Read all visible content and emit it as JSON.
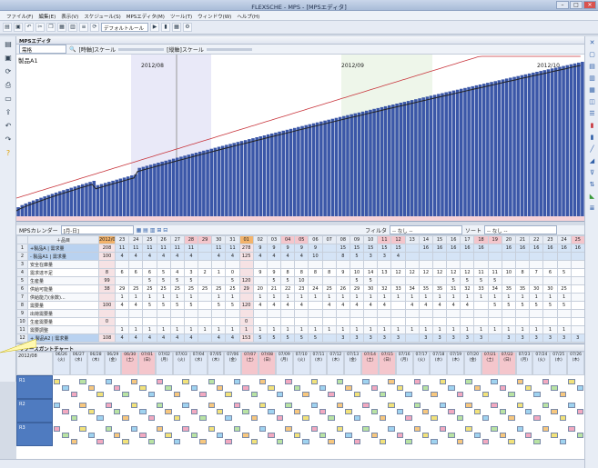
{
  "window": {
    "title": "FLEXSCHE - MPS - [MPSエディタ]"
  },
  "menu": [
    "ファイル(F)",
    "編集(E)",
    "表示(V)",
    "スケジュール(S)",
    "MPSエディタ(M)",
    "ツール(T)",
    "ウィンドウ(W)",
    "ヘルプ(H)"
  ],
  "toolbar": {
    "rule_combo": "デフォルトルール"
  },
  "editor": {
    "tab_label": "MPSエディタ",
    "filter_value": "需格",
    "scale_label": "[時軸]スケール",
    "scale2_label": "[縦軸]スケール",
    "item_title": "製品A1",
    "month_labels": [
      "2012/08",
      "2012/09",
      "2012/10"
    ]
  },
  "grid": {
    "calendar_label": "MPSカレンダー",
    "calendar_value": "[月-日]",
    "filter_label": "フィルタ",
    "filter_value": "-- なし --",
    "sort_label": "ソート",
    "sort_value": "-- なし --",
    "item_header": "＋品目",
    "month_a": "2012/07",
    "month_b": "2012/08",
    "days": [
      "23",
      "24",
      "25",
      "26",
      "27",
      "28",
      "29",
      "30",
      "31",
      "01",
      "02",
      "03",
      "04",
      "05",
      "06",
      "07",
      "08",
      "09",
      "10",
      "11",
      "12",
      "13",
      "14",
      "15",
      "16",
      "17",
      "18",
      "19",
      "20",
      "21",
      "22",
      "23",
      "24",
      "25"
    ],
    "rows": [
      {
        "no": "1",
        "label": "+製品A | 需求量",
        "vals": [
          "208",
          "11",
          "11",
          "11",
          "11",
          "11",
          "11",
          "",
          "11",
          "11",
          "278",
          "9",
          "9",
          "9",
          "9",
          "9",
          "",
          "15",
          "15",
          "15",
          "15",
          "15",
          "",
          "16",
          "16",
          "16",
          "16",
          "16",
          "",
          "16",
          "16",
          "16",
          "16",
          "16",
          "16"
        ]
      },
      {
        "no": "2",
        "label": "- 製品A1 | 需求量",
        "vals": [
          "100",
          "4",
          "4",
          "4",
          "4",
          "4",
          "4",
          "",
          "4",
          "4",
          "125",
          "4",
          "4",
          "4",
          "4",
          "10",
          "",
          "8",
          "5",
          "3",
          "3",
          "4",
          "",
          "",
          "",
          "",
          "",
          "",
          "",
          "",
          "",
          "",
          "",
          "",
          ""
        ]
      },
      {
        "no": "3",
        "label": "安全在庫量",
        "vals": []
      },
      {
        "no": "4",
        "label": "需求達不足",
        "vals": [
          "8",
          "6",
          "6",
          "6",
          "5",
          "4",
          "3",
          "2",
          "1",
          "0",
          "",
          "9",
          "9",
          "8",
          "8",
          "8",
          "8",
          "9",
          "10",
          "14",
          "13",
          "12",
          "12",
          "12",
          "12",
          "12",
          "12",
          "11",
          "11",
          "10",
          "8",
          "7",
          "6",
          "5"
        ]
      },
      {
        "no": "5",
        "label": "生産量",
        "vals": [
          "99",
          "",
          "",
          "5",
          "5",
          "5",
          "5",
          "",
          "",
          "5",
          "120",
          "",
          "5",
          "5",
          "10",
          "",
          "",
          "",
          "5",
          "5",
          "",
          "",
          "",
          "",
          "",
          "5",
          "5",
          "5",
          "5",
          "",
          "",
          "",
          "",
          ""
        ]
      },
      {
        "no": "6",
        "label": "供給可能量",
        "vals": [
          "38",
          "29",
          "25",
          "25",
          "25",
          "25",
          "25",
          "25",
          "25",
          "25",
          "29",
          "20",
          "21",
          "22",
          "23",
          "24",
          "25",
          "26",
          "29",
          "30",
          "32",
          "33",
          "34",
          "35",
          "35",
          "31",
          "32",
          "33",
          "34",
          "35",
          "35",
          "30",
          "30",
          "25"
        ]
      },
      {
        "no": "7",
        "label": "供給能力(余数)...",
        "vals": [
          "",
          "1",
          "1",
          "1",
          "1",
          "1",
          "1",
          "",
          "1",
          "1",
          "",
          "1",
          "1",
          "1",
          "1",
          "1",
          "1",
          "1",
          "1",
          "1",
          "1",
          "1",
          "1",
          "1",
          "1",
          "1",
          "1",
          "1",
          "1",
          "1",
          "1",
          "1",
          "1",
          "1"
        ]
      },
      {
        "no": "8",
        "label": "需要量",
        "vals": [
          "100",
          "4",
          "4",
          "5",
          "5",
          "5",
          "5",
          "",
          "5",
          "5",
          "120",
          "4",
          "4",
          "4",
          "4",
          "",
          "4",
          "4",
          "4",
          "4",
          "4",
          "",
          "4",
          "4",
          "4",
          "4",
          "4",
          "",
          "5",
          "5",
          "5",
          "5",
          "5",
          "5"
        ]
      },
      {
        "no": "9",
        "label": "出荷需要量",
        "vals": [
          "",
          "",
          "",
          "",
          "",
          "",
          "",
          "",
          "",
          "",
          "",
          "",
          "",
          "",
          "",
          "",
          "",
          "",
          "",
          "",
          "",
          "",
          "",
          "",
          "",
          "",
          "",
          "",
          "",
          "",
          "",
          "",
          "",
          ""
        ]
      },
      {
        "no": "10",
        "label": "生産需要量",
        "vals": [
          "0",
          "",
          "",
          "",
          "",
          "",
          "",
          "",
          "",
          "",
          "0",
          "",
          "",
          "",
          "",
          "",
          "",
          "",
          "",
          "",
          "",
          "",
          "",
          "",
          "",
          "",
          "",
          "",
          "",
          "",
          "",
          "",
          "",
          ""
        ]
      },
      {
        "no": "11",
        "label": "需要調整",
        "vals": [
          "",
          "1",
          "1",
          "1",
          "1",
          "1",
          "1",
          "1",
          "1",
          "1",
          "1",
          "1",
          "1",
          "1",
          "1",
          "1",
          "1",
          "1",
          "1",
          "1",
          "1",
          "1",
          "1",
          "1",
          "1",
          "1",
          "1",
          "1",
          "1",
          "1",
          "1",
          "1",
          "1",
          "1"
        ]
      },
      {
        "no": "12",
        "label": "+ 製品A2 | 需求量",
        "vals": [
          "108",
          "4",
          "4",
          "4",
          "4",
          "4",
          "4",
          "",
          "4",
          "4",
          "153",
          "5",
          "5",
          "5",
          "5",
          "5",
          "",
          "3",
          "3",
          "3",
          "3",
          "3",
          "",
          "3",
          "3",
          "3",
          "3",
          "3",
          "",
          "3",
          "3",
          "3",
          "3",
          "3",
          "3"
        ]
      }
    ]
  },
  "gantt": {
    "title": "リソースガントチャート",
    "month": "2012/08",
    "dates": [
      "06/26",
      "06/27",
      "06/28",
      "06/29",
      "06/30",
      "07/01",
      "07/02",
      "07/03",
      "07/04",
      "07/05",
      "07/06",
      "07/07",
      "07/08",
      "07/09",
      "07/10",
      "07/11",
      "07/12",
      "07/13",
      "07/14",
      "07/15",
      "07/16",
      "07/17",
      "07/18",
      "07/19",
      "07/20",
      "07/21",
      "07/22",
      "07/23",
      "07/24",
      "07/25",
      "07/26"
    ],
    "weekdays": [
      "火",
      "水",
      "木",
      "金",
      "土",
      "日",
      "月",
      "火",
      "水",
      "木",
      "金",
      "土",
      "日",
      "月",
      "火",
      "水",
      "木",
      "金",
      "土",
      "日",
      "月",
      "火",
      "水",
      "木",
      "金",
      "土",
      "日",
      "月",
      "火",
      "水",
      "木"
    ],
    "resources": [
      "R1",
      "R2",
      "R3"
    ]
  },
  "colors": {
    "bar": "#3b57a8",
    "line_red": "#c8343b",
    "line_black": "#222222",
    "header_pink": "#f4c6cc",
    "row_blue": "#d5e4f6"
  }
}
